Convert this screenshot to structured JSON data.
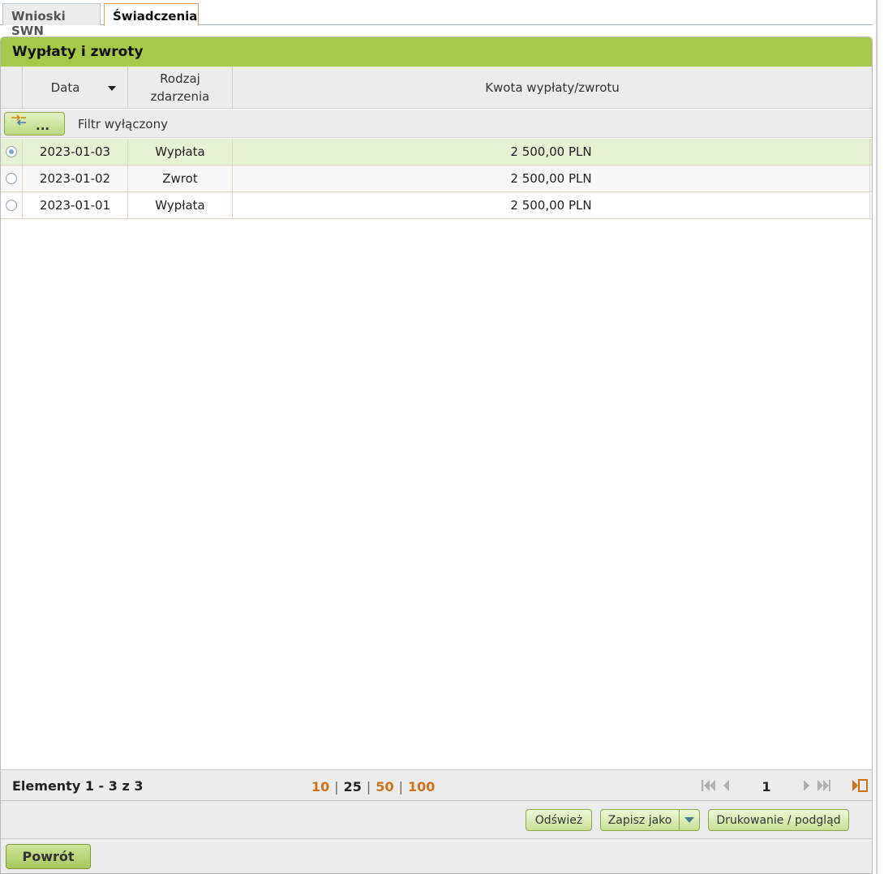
{
  "tabs": [
    {
      "label": "Wnioski SWN",
      "active": false
    },
    {
      "label": "Świadczenia",
      "active": true
    }
  ],
  "panel": {
    "title": "Wypłaty i zwroty"
  },
  "grid": {
    "columns": {
      "date": "Data",
      "event_type_line1": "Rodzaj",
      "event_type_line2": "zdarzenia",
      "amount": "Kwota wypłaty/zwrotu"
    },
    "filter": {
      "button_label": "...",
      "status": "Filtr wyłączony"
    },
    "rows": [
      {
        "date": "2023-01-03",
        "type": "Wypłata",
        "amount": "2 500,00 PLN",
        "selected": true
      },
      {
        "date": "2023-01-02",
        "type": "Zwrot",
        "amount": "2 500,00 PLN",
        "selected": false
      },
      {
        "date": "2023-01-01",
        "type": "Wypłata",
        "amount": "2 500,00 PLN",
        "selected": false
      }
    ]
  },
  "pager": {
    "info": "Elementy 1 - 3 z 3",
    "page_sizes": [
      "10",
      "25",
      "50",
      "100"
    ],
    "current_size": "25",
    "page": "1"
  },
  "actions": {
    "refresh": "Odśwież",
    "save_as": "Zapisz jako",
    "print": "Drukowanie / podgląd"
  },
  "footer": {
    "back": "Powrót"
  },
  "colors": {
    "header_green": "#a8c84a",
    "link_orange": "#d07018",
    "selected_row": "#e6f0d2"
  }
}
